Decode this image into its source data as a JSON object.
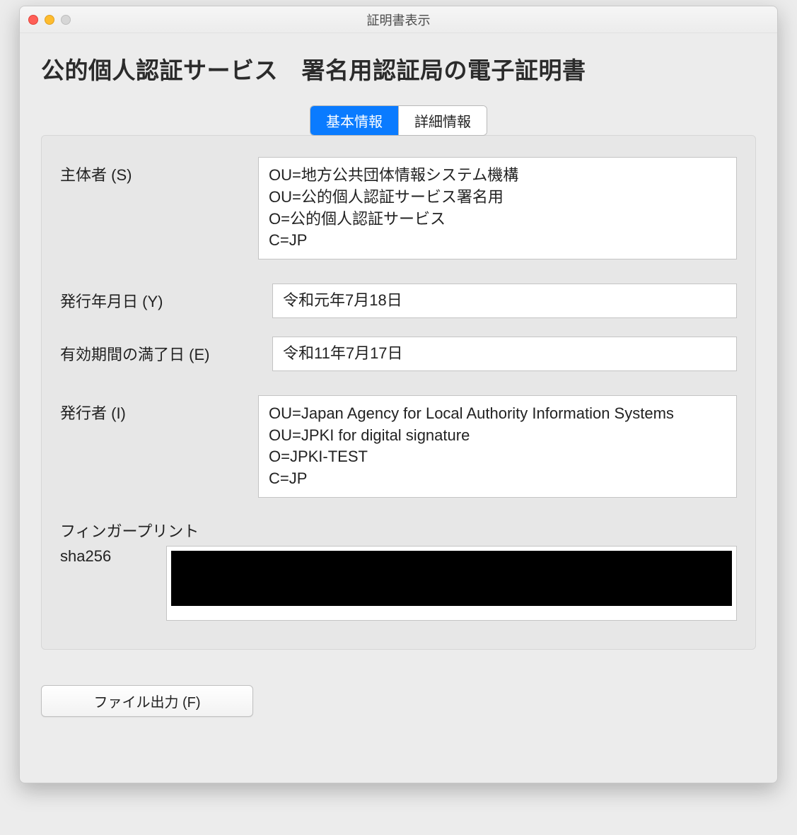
{
  "window": {
    "title": "証明書表示"
  },
  "heading": "公的個人認証サービス　署名用認証局の電子証明書",
  "tabs": {
    "basic": "基本情報",
    "detail": "詳細情報",
    "active": "basic"
  },
  "fields": {
    "subject": {
      "label": "主体者 (S)",
      "value": "OU=地方公共団体情報システム機構\nOU=公的個人認証サービス署名用\nO=公的個人認証サービス\nC=JP"
    },
    "issued": {
      "label": "発行年月日 (Y)",
      "value": "令和元年7月18日"
    },
    "expires": {
      "label": "有効期間の満了日 (E)",
      "value": "令和11年7月17日"
    },
    "issuer": {
      "label": "発行者 (I)",
      "value": "OU=Japan Agency for Local Authority Information Systems\nOU=JPKI for digital signature\nO=JPKI-TEST\nC=JP"
    }
  },
  "fingerprint": {
    "title": "フィンガープリント",
    "algo": "sha256",
    "value_redacted": true
  },
  "footer": {
    "export": "ファイル出力 (F)"
  }
}
